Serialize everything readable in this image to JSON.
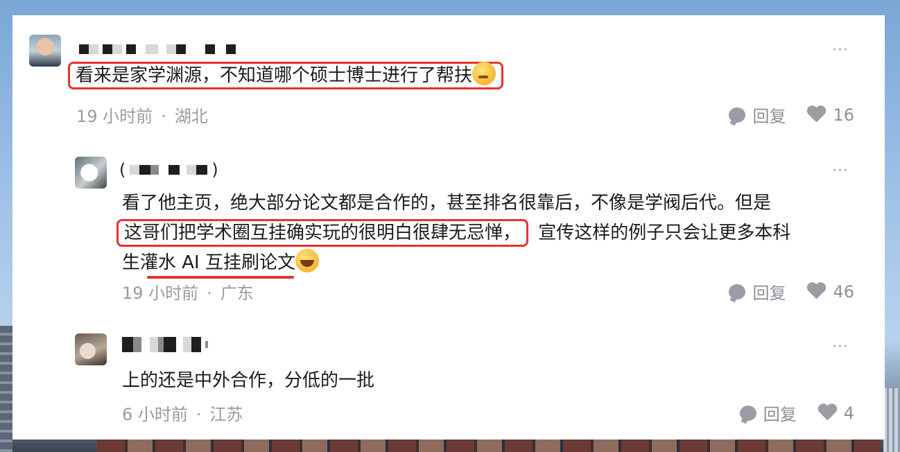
{
  "colors": {
    "highlight_red": "#e8322c",
    "meta_gray": "#9a9aa4",
    "text": "#1b1b1b"
  },
  "comments": [
    {
      "nickname_parts": [
        "(",
        ")"
      ],
      "content": "看来是家学渊源，不知道哪个硕士博士进行了帮扶",
      "emoji": "thinking-face",
      "time": "19 小时前",
      "location": "湖北",
      "reply_label": "回复",
      "likes": "16",
      "more": "···"
    },
    {
      "nickname_parts": [
        "(",
        ")"
      ],
      "content_line1": "看了他主页，绝大部分论文都是合作的，甚至排名很靠后，不像是学阀后代。但是",
      "content_line2_highlight": "这哥们把学术圈互挂确实玩的很明白很肆无忌惮，",
      "content_line2_rest": "宣传这样的例子只会让更多本科",
      "content_line3": "生灌水 AI 互挂刷论文",
      "emoji": "laughing-crying-face",
      "time": "19 小时前",
      "location": "广东",
      "reply_label": "回复",
      "likes": "46",
      "more": "···"
    },
    {
      "content": "上的还是中外合作，分低的一批",
      "time": "6 小时前",
      "location": "江苏",
      "reply_label": "回复",
      "likes": "4",
      "more": "···"
    }
  ],
  "meta_separator": "·"
}
